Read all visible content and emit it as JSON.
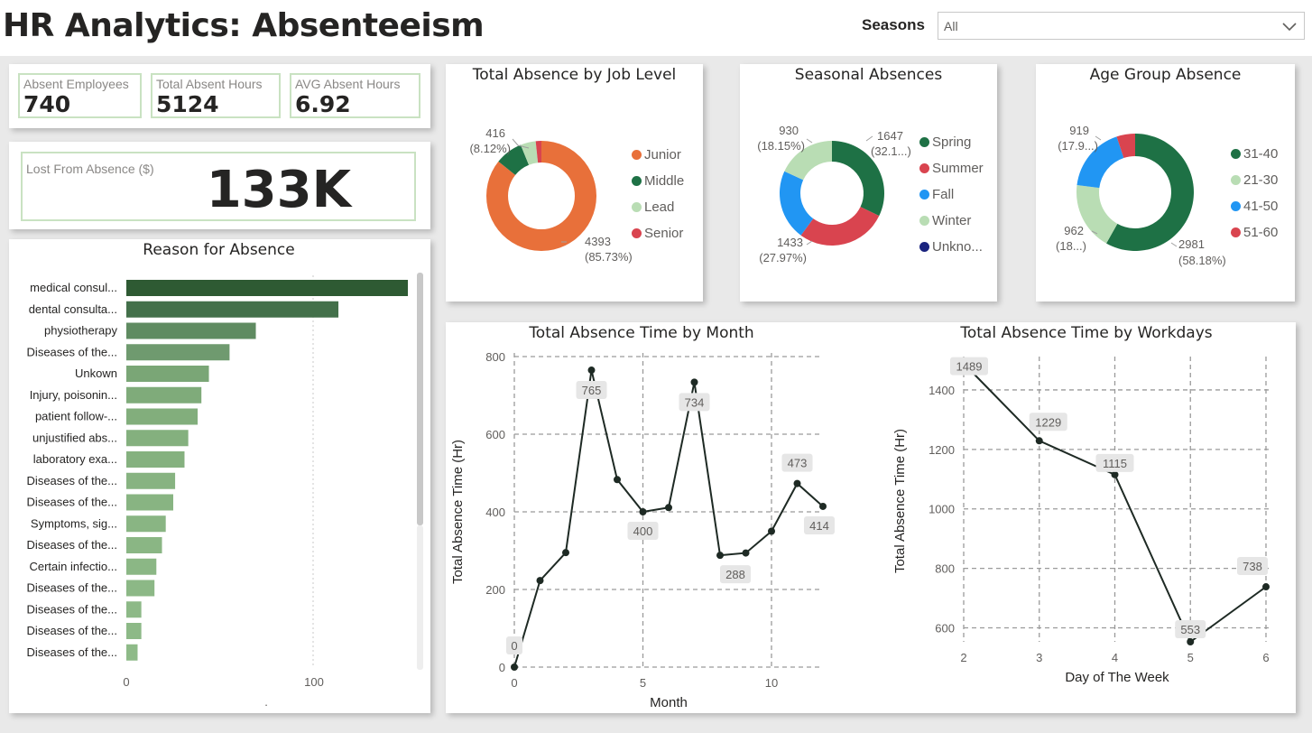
{
  "header": {
    "title": "HR Analytics: Absenteeism",
    "seasons_label": "Seasons",
    "seasons_value": "All"
  },
  "kpis": [
    {
      "label": "Absent Employees",
      "value": "740"
    },
    {
      "label": "Total Absent Hours",
      "value": "5124"
    },
    {
      "label": "AVG Absent Hours",
      "value": "6.92"
    }
  ],
  "lost": {
    "label": "Lost From Absence ($)",
    "value": "133K"
  },
  "reason_chart": {
    "title": "Reason for Absence",
    "xaxis_ticks": [
      "0",
      "100"
    ],
    "footer_mark": "."
  },
  "job_level": {
    "title": "Total Absence by Job Level",
    "labels": {
      "junior_val": "4393",
      "junior_pct": "(85.73%)",
      "middle_val": "416",
      "middle_pct": "(8.12%)"
    },
    "legend": [
      "Junior",
      "Middle",
      "Lead",
      "Senior"
    ]
  },
  "seasonal": {
    "title": "Seasonal Absences",
    "labels": {
      "spring_val": "1647",
      "spring_pct": "(32.1...)",
      "winter_val": "930",
      "winter_pct": "(18.15%)",
      "summer_val": "1433",
      "summer_pct": "(27.97%)"
    },
    "legend": [
      "Spring",
      "Summer",
      "Fall",
      "Winter",
      "Unkno..."
    ]
  },
  "age_group": {
    "title": "Age Group Absence",
    "labels": {
      "a3140_val": "2981",
      "a3140_pct": "(58.18%)",
      "a4150_val": "919",
      "a4150_pct": "(17.9...)",
      "a2130_val": "962",
      "a2130_pct": "(18...)"
    },
    "legend": [
      "31-40",
      "21-30",
      "41-50",
      "51-60"
    ]
  },
  "month_chart": {
    "title": "Total Absence Time by Month"
  },
  "workday_chart": {
    "title": "Total Absence Time by Workdays"
  },
  "colors": {
    "dark_green": "#1e7145",
    "orange": "#e8703a",
    "light_green": "#b9ddb4",
    "red": "#d9444f",
    "blue": "#2196f3",
    "navy": "#1a237e",
    "line": "#1e2a24"
  },
  "chart_data": [
    {
      "type": "bar",
      "title": "Reason for Absence",
      "orientation": "horizontal",
      "categories": [
        "medical consul...",
        "dental consulta...",
        "physiotherapy",
        "Diseases of the...",
        "Unkown",
        "Injury, poisonin...",
        "patient follow-...",
        "unjustified abs...",
        "laboratory exa...",
        "Diseases of the...",
        "Diseases of the...",
        "Symptoms, sig...",
        "Diseases of the...",
        "Certain infectio...",
        "Diseases of the...",
        "Diseases of the...",
        "Diseases of the...",
        "Diseases of the..."
      ],
      "values": [
        150,
        113,
        69,
        55,
        44,
        40,
        38,
        33,
        31,
        26,
        25,
        21,
        19,
        16,
        15,
        8,
        8,
        6
      ],
      "xlim": [
        0,
        160
      ],
      "xticks": [
        0,
        100
      ],
      "colors": [
        "#2e5a33",
        "#43704a",
        "#5f8b61",
        "#6f9a6f",
        "#7aa676",
        "#7fab7a",
        "#82ae7c",
        "#84b07e",
        "#85b17f",
        "#87b381",
        "#88b482",
        "#89b583",
        "#8ab684",
        "#8bb785",
        "#8cb886",
        "#8db987",
        "#8db987",
        "#8eba88"
      ]
    },
    {
      "type": "pie",
      "title": "Total Absence by Job Level",
      "series": [
        {
          "name": "Junior",
          "value": 4393,
          "color": "#e8703a"
        },
        {
          "name": "Middle",
          "value": 416,
          "color": "#1e7145"
        },
        {
          "name": "Lead",
          "value": 230,
          "color": "#b9ddb4"
        },
        {
          "name": "Senior",
          "value": 85,
          "color": "#d9444f"
        }
      ]
    },
    {
      "type": "pie",
      "title": "Seasonal Absences",
      "series": [
        {
          "name": "Spring",
          "value": 1647,
          "color": "#1e7145"
        },
        {
          "name": "Summer",
          "value": 1433,
          "color": "#d9444f"
        },
        {
          "name": "Fall",
          "value": 1114,
          "color": "#2196f3"
        },
        {
          "name": "Winter",
          "value": 930,
          "color": "#b9ddb4"
        },
        {
          "name": "Unkno...",
          "value": 0,
          "color": "#1a237e"
        }
      ]
    },
    {
      "type": "pie",
      "title": "Age Group Absence",
      "series": [
        {
          "name": "31-40",
          "value": 2981,
          "color": "#1e7145"
        },
        {
          "name": "21-30",
          "value": 962,
          "color": "#b9ddb4"
        },
        {
          "name": "41-50",
          "value": 919,
          "color": "#2196f3"
        },
        {
          "name": "51-60",
          "value": 262,
          "color": "#d9444f"
        }
      ]
    },
    {
      "type": "line",
      "title": "Total Absence Time by Month",
      "xlabel": "Month",
      "ylabel": "Total Absence Time (Hr)",
      "x": [
        0,
        1,
        2,
        3,
        4,
        5,
        6,
        7,
        8,
        9,
        10,
        11,
        12
      ],
      "y": [
        0,
        223,
        295,
        765,
        483,
        400,
        411,
        734,
        288,
        294,
        350,
        473,
        414
      ],
      "labeled_points": {
        "0": "0",
        "3": "765",
        "5": "400",
        "7": "734",
        "8": "288",
        "11": "473",
        "12": "414"
      },
      "xlim": [
        0,
        12.5
      ],
      "ylim": [
        0,
        800
      ],
      "xticks": [
        0,
        5,
        10
      ],
      "yticks": [
        0,
        200,
        400,
        600,
        800
      ],
      "grid": true
    },
    {
      "type": "line",
      "title": "Total Absence Time by Workdays",
      "xlabel": "Day of The Week",
      "ylabel": "Total Absence Time (Hr)",
      "x": [
        2,
        3,
        4,
        5,
        6
      ],
      "y": [
        1489,
        1229,
        1115,
        553,
        738
      ],
      "labeled_points": {
        "2": "1489",
        "3": "1229",
        "4": "1115",
        "5": "553",
        "6": "738"
      },
      "xlim": [
        2,
        6
      ],
      "ylim": [
        550,
        1500
      ],
      "xticks": [
        2,
        3,
        4,
        5,
        6
      ],
      "yticks": [
        600,
        800,
        1000,
        1200,
        1400
      ],
      "grid": true
    }
  ]
}
